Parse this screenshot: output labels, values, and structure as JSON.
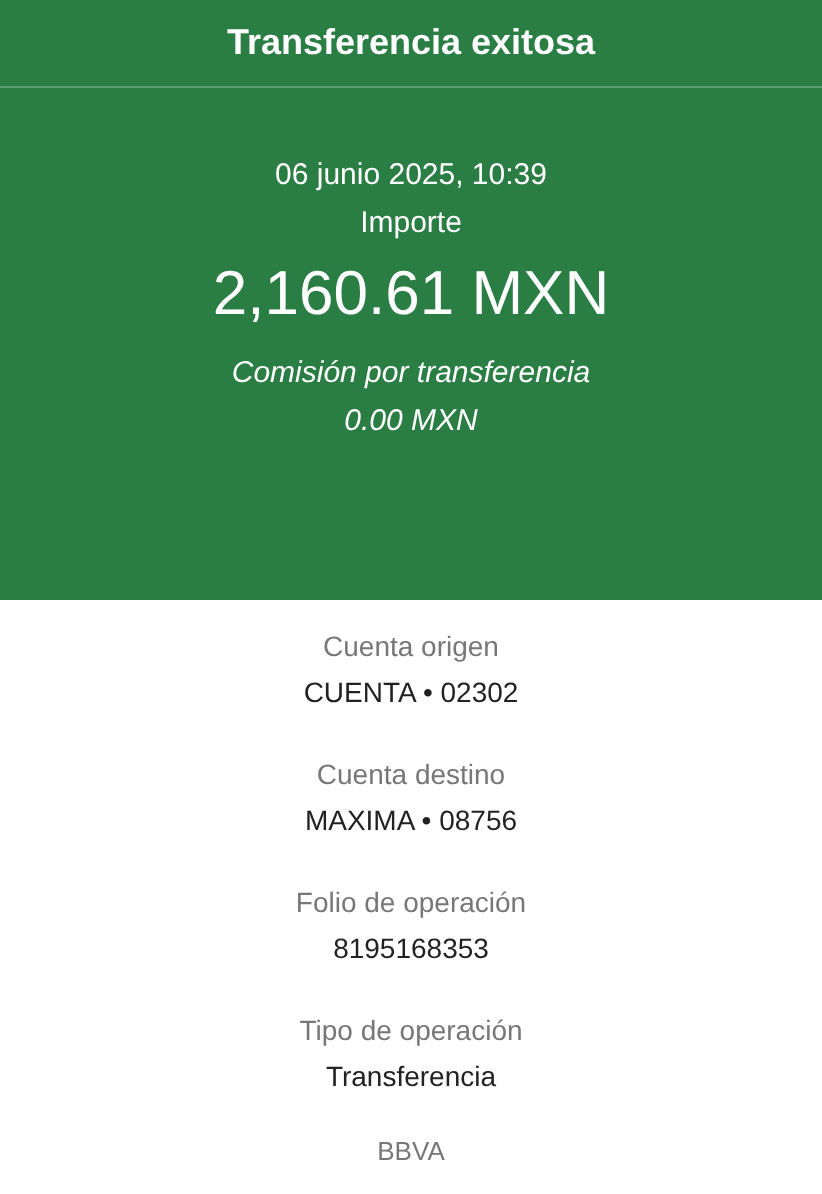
{
  "header": {
    "title": "Transferencia exitosa",
    "date": "06 junio 2025, 10:39",
    "amount_label": "Importe",
    "amount": "2,160.61 MXN",
    "fee_label": "Comisión por transferencia",
    "fee": "0.00 MXN"
  },
  "details": [
    {
      "label": "Cuenta origen",
      "value": "CUENTA • 02302"
    },
    {
      "label": "Cuenta destino",
      "value": "MAXIMA • 08756"
    },
    {
      "label": "Folio de operación",
      "value": "8195168353"
    },
    {
      "label": "Tipo de operación",
      "value": "Transferencia"
    }
  ],
  "footer": "BBVA"
}
